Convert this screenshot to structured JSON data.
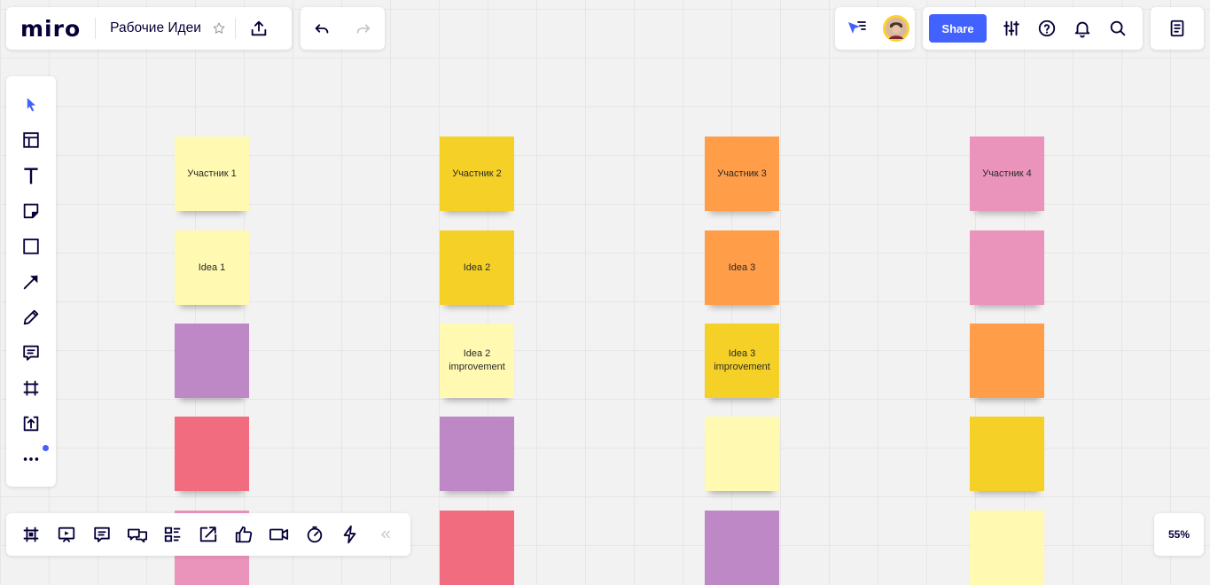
{
  "app": {
    "logo": "miro",
    "board_title": "Рабочие Идеи"
  },
  "header": {
    "share_label": "Share",
    "icons": {
      "star": "star-icon",
      "export": "upload-icon",
      "undo": "undo-icon",
      "redo": "redo-icon",
      "collaboration_cursor": "cursor-filter-icon",
      "avatar": "user-avatar",
      "settings": "sliders-icon",
      "help": "help-icon",
      "notifications": "bell-icon",
      "search": "search-icon",
      "notes": "notes-panel-icon"
    }
  },
  "left_toolbar": {
    "tools": [
      "select",
      "templates",
      "text",
      "sticky-note",
      "shape",
      "arrow",
      "pen",
      "comment",
      "frame",
      "upload",
      "more"
    ],
    "more_indicator": true
  },
  "board": {
    "columns": [
      {
        "notes": [
          {
            "text": "Участник 1",
            "color": "#fff9b1"
          },
          {
            "text": "Idea 1",
            "color": "#fff9b1"
          },
          {
            "text": "",
            "color": "#be88c7"
          },
          {
            "text": "",
            "color": "#f16c7f"
          },
          {
            "text": "",
            "color": "#ea94bb"
          }
        ]
      },
      {
        "notes": [
          {
            "text": "Участник 2",
            "color": "#f5d128"
          },
          {
            "text": "Idea 2",
            "color": "#f5d128"
          },
          {
            "text": "Idea 2 improvement",
            "color": "#fff9b1"
          },
          {
            "text": "",
            "color": "#be88c7"
          },
          {
            "text": "",
            "color": "#f16c7f"
          }
        ]
      },
      {
        "notes": [
          {
            "text": "Участник 3",
            "color": "#ff9d48"
          },
          {
            "text": "Idea 3",
            "color": "#ff9d48"
          },
          {
            "text": "Idea 3 improvement",
            "color": "#f5d128"
          },
          {
            "text": "",
            "color": "#fff9b1"
          },
          {
            "text": "",
            "color": "#be88c7"
          }
        ]
      },
      {
        "notes": [
          {
            "text": "Участник 4",
            "color": "#ea94bb"
          },
          {
            "text": "",
            "color": "#ea94bb"
          },
          {
            "text": "",
            "color": "#ff9d48"
          },
          {
            "text": "",
            "color": "#f5d128"
          },
          {
            "text": "",
            "color": "#fff9b1"
          }
        ]
      }
    ]
  },
  "bottom_toolbar": {
    "items": [
      "frames",
      "presentation",
      "comments",
      "chat",
      "cards",
      "screen-share",
      "voting",
      "video",
      "timer",
      "lightning",
      "collapse"
    ]
  },
  "zoom": {
    "level": "55%"
  },
  "colors": {
    "accent": "#4262ff",
    "avatar_ring": "#ffd02f"
  }
}
